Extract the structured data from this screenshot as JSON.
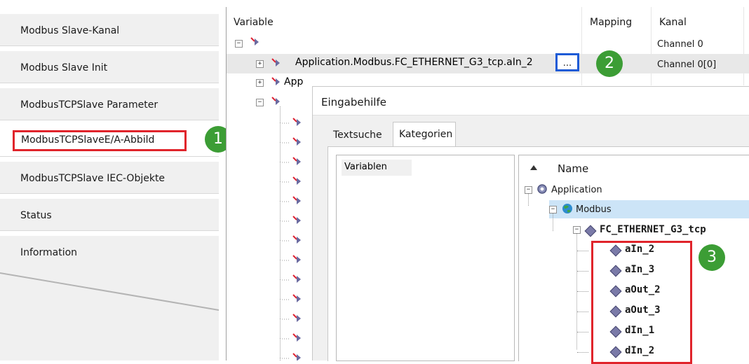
{
  "nav": {
    "items": [
      {
        "label": "Modbus Slave-Kanal"
      },
      {
        "label": "Modbus Slave Init"
      },
      {
        "label": "ModbusTCPSlave Parameter"
      },
      {
        "label": "ModbusTCPSlaveE/A-Abbild"
      },
      {
        "label": "ModbusTCPSlave IEC-Objekte"
      },
      {
        "label": "Status"
      },
      {
        "label": "Information"
      }
    ],
    "selected_index": 3
  },
  "badges": {
    "one": "1",
    "two": "2",
    "three": "3"
  },
  "grid": {
    "columns": {
      "variable": "Variable",
      "mapping": "Mapping",
      "kanal": "Kanal"
    },
    "rows": [
      {
        "variable": "",
        "channel": "Channel 0"
      },
      {
        "variable": "Application.Modbus.FC_ETHERNET_G3_tcp.aIn_2",
        "channel": "Channel 0[0]"
      },
      {
        "variable": "App",
        "channel": ""
      }
    ],
    "ellipsis_label": "..."
  },
  "dialog": {
    "title": "Eingabehilfe",
    "tabs": [
      {
        "label": "Textsuche"
      },
      {
        "label": "Kategorien"
      }
    ],
    "active_tab": "Kategorien",
    "categories": [
      {
        "label": "Variablen"
      }
    ],
    "tree_header": "Name",
    "tree": {
      "application": "Application",
      "modbus": "Modbus",
      "device": "FC_ETHERNET_G3_tcp",
      "leaves": [
        "aIn_2",
        "aIn_3",
        "aOut_2",
        "aOut_3",
        "dIn_1",
        "dIn_2"
      ]
    }
  },
  "colors": {
    "highlight_red": "#e0242b",
    "badge_green": "#3c9d35",
    "button_blue": "#1e5bd6",
    "selection_blue": "#cce4f7"
  }
}
